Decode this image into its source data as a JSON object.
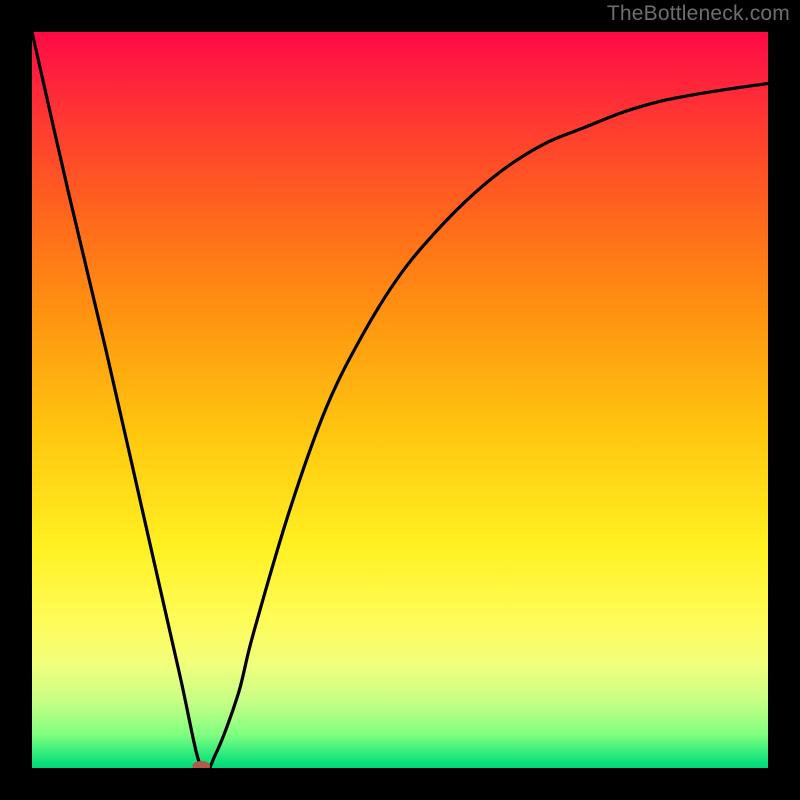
{
  "watermark": "TheBottleneck.com",
  "chart_data": {
    "type": "line",
    "title": "",
    "xlabel": "",
    "ylabel": "",
    "xlim": [
      0,
      100
    ],
    "ylim": [
      0,
      100
    ],
    "grid": false,
    "legend": false,
    "series": [
      {
        "name": "curve",
        "x": [
          0,
          5,
          10,
          15,
          20,
          23,
          25,
          28,
          30,
          35,
          40,
          45,
          50,
          55,
          60,
          65,
          70,
          75,
          80,
          85,
          90,
          95,
          100
        ],
        "y": [
          100,
          78,
          57,
          35,
          13,
          0,
          2,
          10,
          18,
          35,
          49,
          59,
          67,
          73,
          78,
          82,
          85,
          87,
          89,
          90.5,
          91.5,
          92.3,
          93
        ]
      }
    ],
    "background_gradient": {
      "stops": [
        {
          "offset": 0.0,
          "color": "#ff0a47"
        },
        {
          "offset": 0.13,
          "color": "#ff3c30"
        },
        {
          "offset": 0.26,
          "color": "#ff6a1a"
        },
        {
          "offset": 0.4,
          "color": "#ff9910"
        },
        {
          "offset": 0.55,
          "color": "#ffc80f"
        },
        {
          "offset": 0.7,
          "color": "#fff122"
        },
        {
          "offset": 0.8,
          "color": "#fffc59"
        },
        {
          "offset": 0.86,
          "color": "#f1ff7d"
        },
        {
          "offset": 0.91,
          "color": "#c6ff85"
        },
        {
          "offset": 0.955,
          "color": "#7fff80"
        },
        {
          "offset": 0.985,
          "color": "#20e87b"
        },
        {
          "offset": 1.0,
          "color": "#00d877"
        }
      ]
    },
    "marker": {
      "x": 23,
      "y": 0,
      "rx": 9,
      "ry": 5,
      "color": "#b15a4b"
    }
  }
}
